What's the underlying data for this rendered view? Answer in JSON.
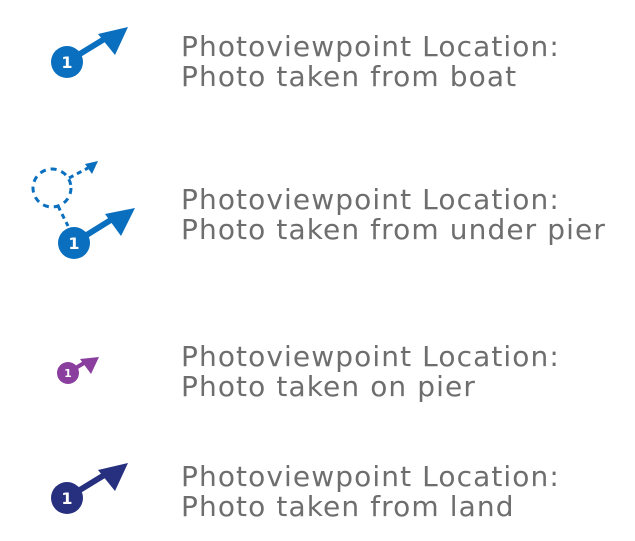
{
  "legend": {
    "items": [
      {
        "id": "boat",
        "number": "1",
        "color": "#0a6fbf",
        "icon": "viewpoint-arrow-icon",
        "line1": "Photoviewpoint Location:",
        "line2": "Photo taken from boat"
      },
      {
        "id": "under-pier",
        "number": "1",
        "color": "#0a6fbf",
        "icon": "viewpoint-arrow-dashed-icon",
        "line1": "Photoviewpoint Location:",
        "line2": "Photo taken from under pier"
      },
      {
        "id": "on-pier",
        "number": "1",
        "color": "#8a3f9e",
        "icon": "viewpoint-arrow-small-icon",
        "line1": "Photoviewpoint Location:",
        "line2": "Photo taken on pier"
      },
      {
        "id": "land",
        "number": "1",
        "color": "#27307f",
        "icon": "viewpoint-arrow-icon",
        "line1": "Photoviewpoint Location:",
        "line2": "Photo taken from land"
      }
    ]
  }
}
